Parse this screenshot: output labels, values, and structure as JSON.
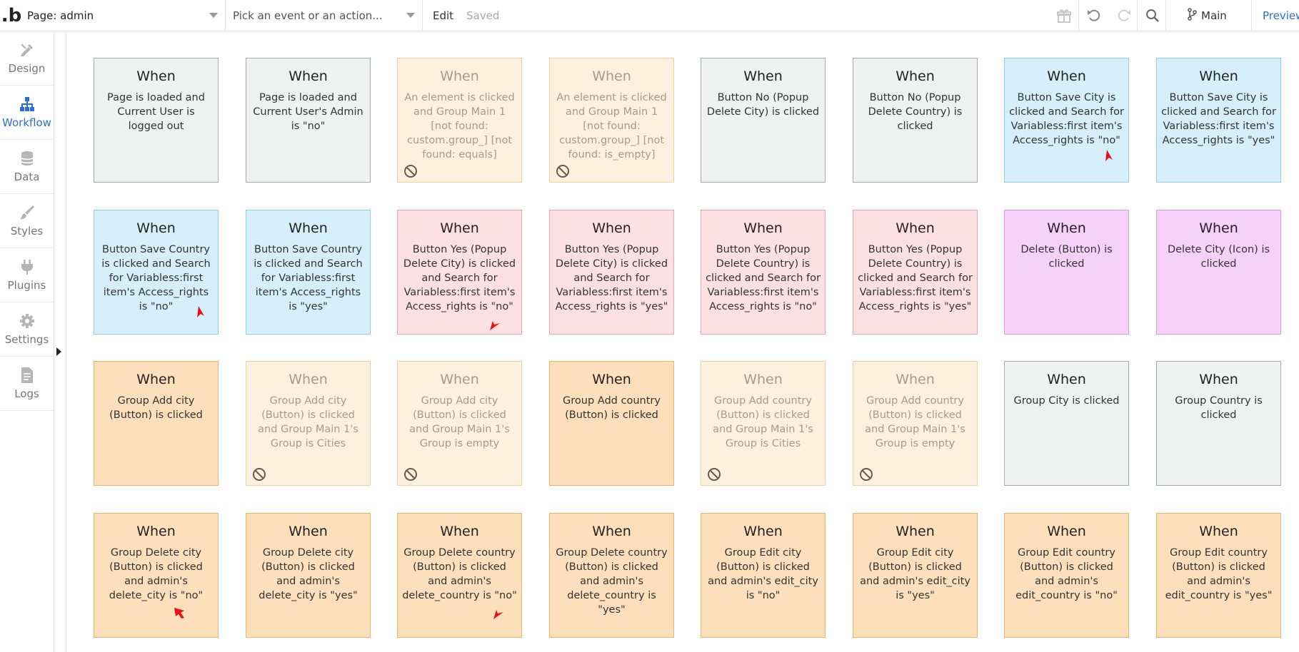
{
  "topbar": {
    "page_label": "Page: admin",
    "event_placeholder": "Pick an event or an action...",
    "edit_label": "Edit",
    "saved_label": "Saved",
    "branch_label": "Main",
    "preview_label": "Preview"
  },
  "sidebar": {
    "items": [
      {
        "label": "Design",
        "icon": "design-icon"
      },
      {
        "label": "Workflow",
        "icon": "workflow-icon",
        "active": true
      },
      {
        "label": "Data",
        "icon": "data-icon"
      },
      {
        "label": "Styles",
        "icon": "styles-icon"
      },
      {
        "label": "Plugins",
        "icon": "plugins-icon"
      },
      {
        "label": "Settings",
        "icon": "settings-icon"
      },
      {
        "label": "Logs",
        "icon": "logs-icon"
      }
    ]
  },
  "colors": {
    "gray": "#f0f1f1",
    "blue": "#d6f0fb",
    "pink": "#fde0e4",
    "purple": "#f6d2fa",
    "orange": "#fde0bb",
    "orange_disabled": "#fef0de",
    "accent": "#2a6fdb",
    "annotation_arrow": "#e8101a"
  },
  "events": [
    {
      "when": "When",
      "condition": "Page is loaded and Current User is logged out",
      "color": "gray",
      "disabled": false
    },
    {
      "when": "When",
      "condition": "Page is loaded and Current User's Admin is \"no\"",
      "color": "gray",
      "disabled": false
    },
    {
      "when": "When",
      "condition": "An element is clicked and Group Main 1 [not found: custom.group_] [not found: equals]",
      "color": "orange",
      "disabled": true
    },
    {
      "when": "When",
      "condition": "An element is clicked and Group Main 1 [not found: custom.group_] [not found: is_empty]",
      "color": "orange",
      "disabled": true
    },
    {
      "when": "When",
      "condition": "Button No (Popup Delete City) is clicked",
      "color": "gray",
      "disabled": false
    },
    {
      "when": "When",
      "condition": "Button No (Popup Delete Country) is clicked",
      "color": "gray",
      "disabled": false
    },
    {
      "when": "When",
      "condition": "Button Save City is clicked and Search for Variabless:first item's Access_rights is \"no\"",
      "color": "blue",
      "disabled": false,
      "marked": true
    },
    {
      "when": "When",
      "condition": "Button Save City is clicked and Search for Variabless:first item's Access_rights is \"yes\"",
      "color": "blue",
      "disabled": false
    },
    {
      "when": "When",
      "condition": "Button Save Country is clicked and Search for Variabless:first item's Access_rights is \"no\"",
      "color": "blue",
      "disabled": false,
      "marked": true
    },
    {
      "when": "When",
      "condition": "Button Save Country is clicked and Search for Variabless:first item's Access_rights is \"yes\"",
      "color": "blue",
      "disabled": false
    },
    {
      "when": "When",
      "condition": "Button Yes (Popup Delete City) is clicked and Search for Variabless:first item's Access_rights is \"no\"",
      "color": "pink",
      "disabled": false,
      "marked": true
    },
    {
      "when": "When",
      "condition": "Button Yes (Popup Delete City) is clicked and Search for Variabless:first item's Access_rights is \"yes\"",
      "color": "pink",
      "disabled": false
    },
    {
      "when": "When",
      "condition": "Button Yes (Popup Delete Country) is clicked and Search for Variabless:first item's Access_rights is \"no\"",
      "color": "pink",
      "disabled": false
    },
    {
      "when": "When",
      "condition": "Button Yes (Popup Delete Country) is clicked and Search for Variabless:first item's Access_rights is \"yes\"",
      "color": "pink",
      "disabled": false
    },
    {
      "when": "When",
      "condition": "Delete (Button) is clicked",
      "color": "purple",
      "disabled": false
    },
    {
      "when": "When",
      "condition": "Delete City (Icon) is clicked",
      "color": "purple",
      "disabled": false
    },
    {
      "when": "When",
      "condition": "Group Add city (Button) is clicked",
      "color": "orange",
      "disabled": false
    },
    {
      "when": "When",
      "condition": "Group Add city (Button) is clicked and Group Main 1's Group is Cities",
      "color": "orange",
      "disabled": true
    },
    {
      "when": "When",
      "condition": "Group Add city (Button) is clicked and Group Main 1's Group is empty",
      "color": "orange",
      "disabled": true
    },
    {
      "when": "When",
      "condition": "Group Add country (Button) is clicked",
      "color": "orange",
      "disabled": false
    },
    {
      "when": "When",
      "condition": "Group Add country (Button) is clicked and Group Main 1's Group is Cities",
      "color": "orange",
      "disabled": true
    },
    {
      "when": "When",
      "condition": "Group Add country (Button) is clicked and Group Main 1's Group is empty",
      "color": "orange",
      "disabled": true
    },
    {
      "when": "When",
      "condition": "Group City is clicked",
      "color": "gray",
      "disabled": false
    },
    {
      "when": "When",
      "condition": "Group Country is clicked",
      "color": "gray",
      "disabled": false
    },
    {
      "when": "When",
      "condition": "Group Delete city (Button) is clicked and admin's delete_city is \"no\"",
      "color": "orange",
      "disabled": false,
      "marked": true
    },
    {
      "when": "When",
      "condition": "Group Delete city (Button) is clicked and admin's delete_city is \"yes\"",
      "color": "orange",
      "disabled": false
    },
    {
      "when": "When",
      "condition": "Group Delete country (Button) is clicked and admin's delete_country is \"no\"",
      "color": "orange",
      "disabled": false,
      "marked": true
    },
    {
      "when": "When",
      "condition": "Group Delete country (Button) is clicked and admin's delete_country is \"yes\"",
      "color": "orange",
      "disabled": false
    },
    {
      "when": "When",
      "condition": "Group Edit city (Button) is clicked and admin's edit_city is \"no\"",
      "color": "orange",
      "disabled": false
    },
    {
      "when": "When",
      "condition": "Group Edit city (Button) is clicked and admin's edit_city is \"yes\"",
      "color": "orange",
      "disabled": false
    },
    {
      "when": "When",
      "condition": "Group Edit country (Button) is clicked and admin's edit_country is \"no\"",
      "color": "orange",
      "disabled": false
    },
    {
      "when": "When",
      "condition": "Group Edit country (Button) is clicked and admin's edit_country is \"yes\"",
      "color": "orange",
      "disabled": false
    }
  ]
}
